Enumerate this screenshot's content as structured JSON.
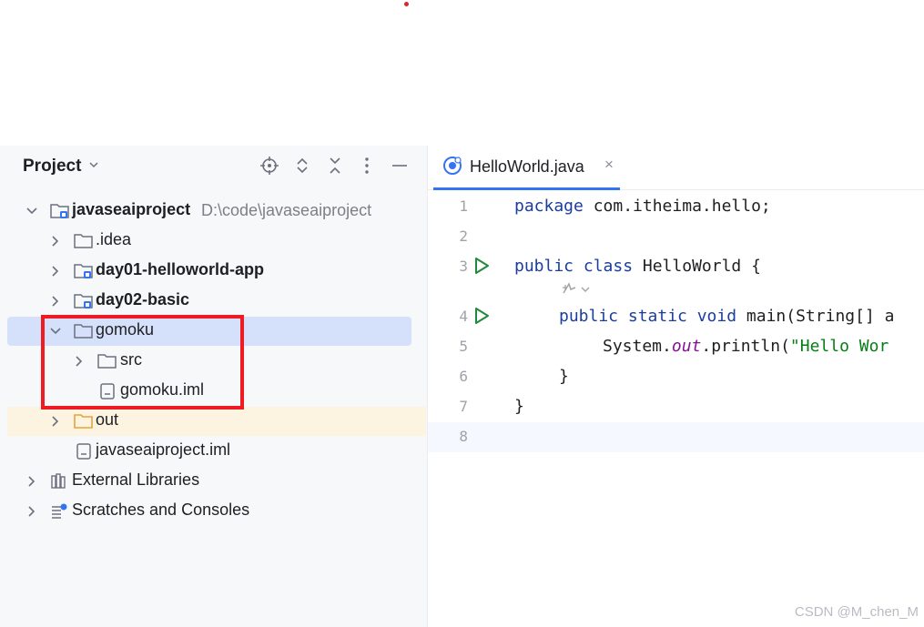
{
  "project_panel": {
    "title": "Project",
    "header_icons": [
      "locate-icon",
      "expand-collapse-icon",
      "collapse-all-icon",
      "more-icon",
      "minimize-icon"
    ],
    "tree": [
      {
        "label": "javaseaiproject",
        "path": "D:\\code\\javaseaiproject",
        "expanded": true,
        "icon": "module-folder-icon"
      },
      {
        "label": ".idea",
        "expanded": false,
        "icon": "folder-icon"
      },
      {
        "label": "day01-helloworld-app",
        "expanded": false,
        "icon": "module-folder-icon"
      },
      {
        "label": "day02-basic",
        "expanded": false,
        "icon": "module-folder-icon"
      },
      {
        "label": "gomoku",
        "expanded": true,
        "selected": true,
        "icon": "folder-icon"
      },
      {
        "label": "src",
        "expanded": false,
        "icon": "folder-icon"
      },
      {
        "label": "gomoku.iml",
        "icon": "iml-file-icon"
      },
      {
        "label": "out",
        "expanded": false,
        "icon": "excluded-folder-icon"
      },
      {
        "label": "javaseaiproject.iml",
        "icon": "iml-file-icon"
      },
      {
        "label": "External Libraries",
        "expanded": false,
        "icon": "libraries-icon"
      },
      {
        "label": "Scratches and Consoles",
        "expanded": false,
        "icon": "scratches-icon"
      }
    ]
  },
  "editor": {
    "tab": {
      "label": "HelloWorld.java",
      "close": "×"
    },
    "lines": [
      {
        "num": "1"
      },
      {
        "num": "2"
      },
      {
        "num": "3"
      },
      {
        "num": "4"
      },
      {
        "num": "5"
      },
      {
        "num": "6"
      },
      {
        "num": "7"
      },
      {
        "num": "8"
      }
    ],
    "code": {
      "l1_kw": "package",
      "l1_rest": " com.itheima.hello;",
      "l3_kw": "public class",
      "l3_rest": " HelloWorld {",
      "l4_kw": "public static void",
      "l4_rest": " main(String[] a",
      "l5_a": "System.",
      "l5_field": "out",
      "l5_b": ".println(",
      "l5_str": "\"Hello Wor",
      "l6": "}",
      "l7": "}"
    }
  },
  "watermark": "CSDN @M_chen_M",
  "colors": {
    "accent": "#3574f0",
    "selection": "#d5e1fa",
    "highlight_box": "#ee1b22",
    "run_icon": "#208a3c"
  }
}
